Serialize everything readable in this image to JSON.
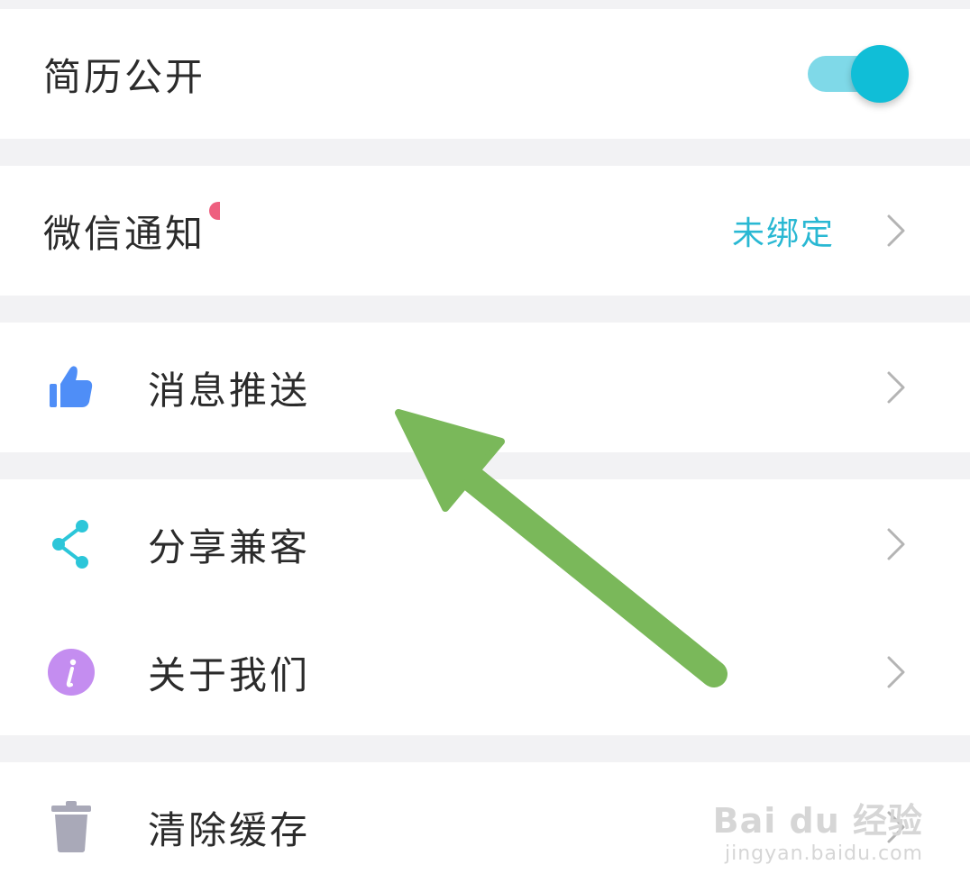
{
  "settings": {
    "resume_public": {
      "label": "简历公开",
      "toggle_on": true,
      "accent_color": "#10bed7"
    },
    "wechat_notify": {
      "label": "微信通知",
      "status": "未绑定",
      "status_color": "#29b8d3",
      "has_badge": true
    },
    "push": {
      "label": "消息推送",
      "icon": "thumbs-up-icon",
      "icon_color": "#4f8ef7"
    },
    "share": {
      "label": "分享兼客",
      "icon": "share-icon",
      "icon_color": "#2cc6d9"
    },
    "about": {
      "label": "关于我们",
      "icon": "info-icon",
      "icon_color": "#c48df0"
    },
    "clear_cache": {
      "label": "清除缓存",
      "icon": "trash-icon",
      "icon_color": "#a9a9b8"
    }
  },
  "annotation": {
    "arrow_color": "#7ab85a"
  },
  "watermark": {
    "brand": "Bai du 经验",
    "url": "jingyan.baidu.com"
  }
}
